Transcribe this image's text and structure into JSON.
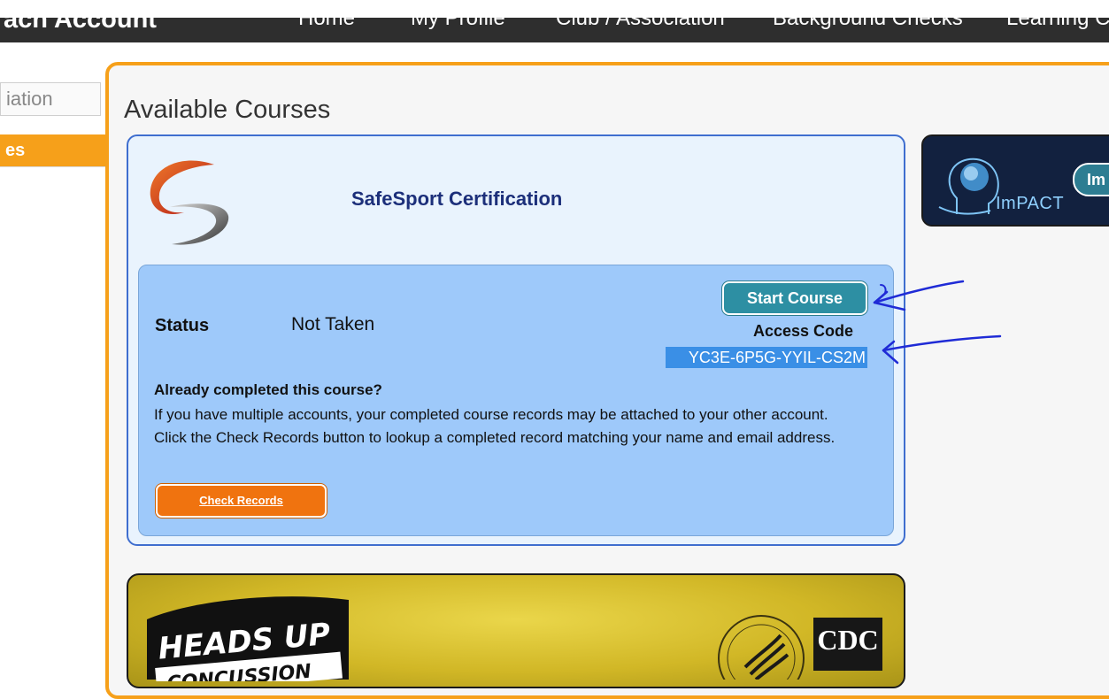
{
  "header": {
    "brand": "ach Account",
    "nav": [
      "Home",
      "My Profile",
      "Club / Association",
      "Background Checks",
      "Learning Ce"
    ]
  },
  "sidebar": {
    "search_text": "iation",
    "active_item": "es"
  },
  "main": {
    "title": "Available Courses",
    "safesport": {
      "name": "SafeSport Certification",
      "status_label": "Status",
      "status_value": "Not Taken",
      "start_button": "Start Course",
      "access_code_label": "Access Code",
      "access_code": "YC3E-6P5G-YYIL-CS2M",
      "completed_question": "Already completed this course?",
      "completed_description": "If you have multiple accounts, your completed course records may be attached to your other account. Click the Check Records button to lookup a completed record matching your name and email address.",
      "check_button": "Check Records"
    },
    "impact": {
      "brand": "ImPACT",
      "button": "Im"
    },
    "headsup": {
      "logo_line1": "HEADS UP",
      "logo_line2": "CONCUSSION",
      "cdc": "CDC"
    }
  },
  "annotation": {
    "mark": "1",
    "color": "#1f2bd6"
  }
}
